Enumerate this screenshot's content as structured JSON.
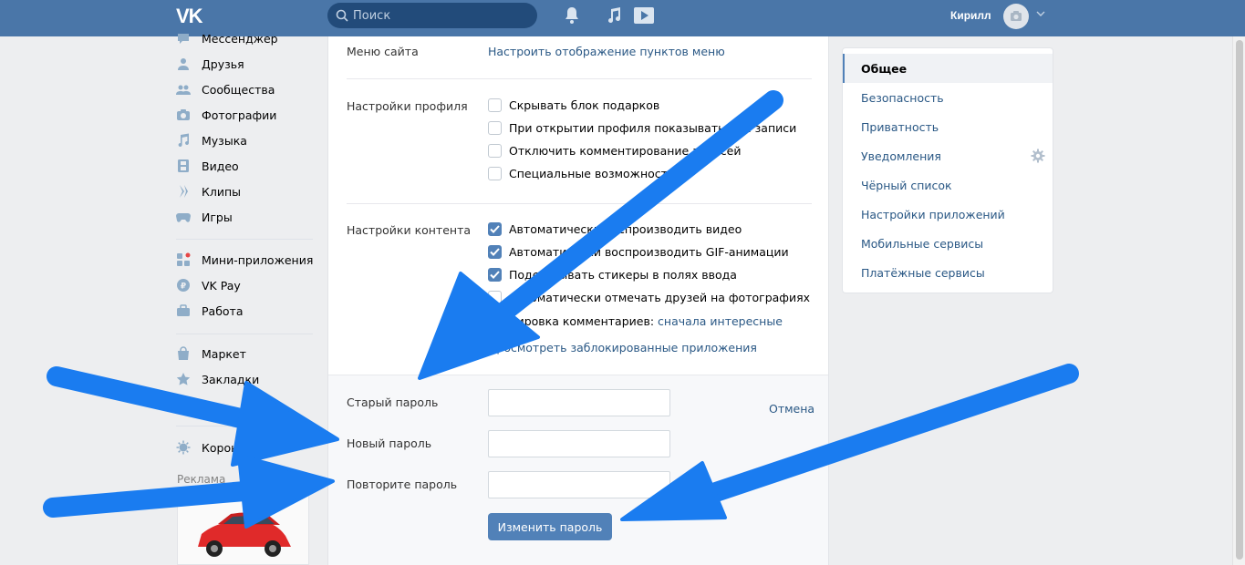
{
  "header": {
    "logo": "VK",
    "search_placeholder": "Поиск",
    "username": "Кирилл"
  },
  "left_nav": {
    "items": [
      {
        "label": "Мессенджер",
        "icon": "messenger-icon"
      },
      {
        "label": "Друзья",
        "icon": "friends-icon"
      },
      {
        "label": "Сообщества",
        "icon": "communities-icon"
      },
      {
        "label": "Фотографии",
        "icon": "camera-icon"
      },
      {
        "label": "Музыка",
        "icon": "music-icon"
      },
      {
        "label": "Видео",
        "icon": "film-icon"
      },
      {
        "label": "Клипы",
        "icon": "clips-icon"
      },
      {
        "label": "Игры",
        "icon": "gamepad-icon"
      },
      {
        "label": "Мини-приложения",
        "icon": "mini-apps-icon"
      },
      {
        "label": "VK Pay",
        "icon": "vkpay-icon"
      },
      {
        "label": "Работа",
        "icon": "briefcase-icon"
      },
      {
        "label": "Маркет",
        "icon": "market-icon"
      },
      {
        "label": "Закладки",
        "icon": "star-icon"
      },
      {
        "label": "Коронавирус",
        "icon": "virus-icon"
      }
    ],
    "ad_label": "Реклама"
  },
  "main": {
    "site_menu": {
      "label": "Меню сайта",
      "link": "Настроить отображение пунктов меню"
    },
    "profile_settings": {
      "label": "Настройки профиля",
      "options": [
        {
          "text": "Скрывать блок подарков",
          "checked": false
        },
        {
          "text": "При открытии профиля показывать мои записи",
          "checked": false
        },
        {
          "text": "Отключить комментирование записей",
          "checked": false
        },
        {
          "text": "Специальные возможности",
          "checked": false
        }
      ]
    },
    "content_settings": {
      "label": "Настройки контента",
      "options": [
        {
          "text": "Автоматически воспроизводить видео",
          "checked": true
        },
        {
          "text": "Автоматически воспроизводить GIF-анимации",
          "checked": true
        },
        {
          "text": "Подсказывать стикеры в полях ввода",
          "checked": true
        },
        {
          "text": "Автоматически отмечать друзей на фотографиях",
          "checked": false
        }
      ],
      "sort_label": "Сортировка комментариев:",
      "sort_value": "сначала интересные",
      "blocked_apps_link": "Просмотреть заблокированные приложения"
    },
    "password": {
      "old_label": "Старый пароль",
      "new_label": "Новый пароль",
      "repeat_label": "Повторите пароль",
      "cancel": "Отмена",
      "submit": "Изменить пароль"
    }
  },
  "right_menu": {
    "items": [
      {
        "label": "Общее",
        "active": true
      },
      {
        "label": "Безопасность",
        "active": false
      },
      {
        "label": "Приватность",
        "active": false
      },
      {
        "label": "Уведомления",
        "active": false
      },
      {
        "label": "Чёрный список",
        "active": false
      },
      {
        "label": "Настройки приложений",
        "active": false
      },
      {
        "label": "Мобильные сервисы",
        "active": false
      },
      {
        "label": "Платёжные сервисы",
        "active": false
      }
    ]
  },
  "colors": {
    "header": "#4a76a8",
    "accent": "#5181b8",
    "link": "#2a5885",
    "annotation_arrow": "#1a7cf0"
  }
}
